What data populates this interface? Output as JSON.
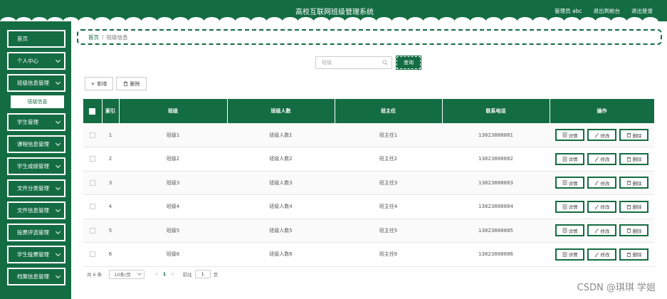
{
  "header": {
    "title": "高校互联网班级管理系统",
    "admin_label": "管理员 abc",
    "front_link": "退出到前台",
    "logout_link": "退出登录"
  },
  "sidebar": {
    "items": [
      {
        "label": "首页",
        "has_chevron": false
      },
      {
        "label": "个人中心",
        "has_chevron": true
      },
      {
        "label": "班级信息管理",
        "has_chevron": true
      },
      {
        "label": "学生管理",
        "has_chevron": true
      },
      {
        "label": "课程信息管理",
        "has_chevron": true
      },
      {
        "label": "学生成绩管理",
        "has_chevron": true
      },
      {
        "label": "文件分类管理",
        "has_chevron": true
      },
      {
        "label": "文件信息管理",
        "has_chevron": true
      },
      {
        "label": "投票评选管理",
        "has_chevron": true
      },
      {
        "label": "学生投票管理",
        "has_chevron": true
      },
      {
        "label": "档案信息管理",
        "has_chevron": true
      }
    ],
    "active_sub": "班级信息"
  },
  "breadcrumb": {
    "home": "首页",
    "separator": "/",
    "current": "班级信息"
  },
  "search": {
    "placeholder": "班级",
    "button": "查询"
  },
  "toolbar": {
    "add": "新增",
    "delete": "删除"
  },
  "table": {
    "headers": {
      "index": "索引",
      "class": "班级",
      "count": "班级人数",
      "teacher": "班主任",
      "phone": "联系电话",
      "ops": "操作"
    },
    "rows": [
      {
        "index": "1",
        "class": "班级1",
        "count": "班级人数1",
        "teacher": "班主任1",
        "phone": "13823888881"
      },
      {
        "index": "2",
        "class": "班级2",
        "count": "班级人数2",
        "teacher": "班主任2",
        "phone": "13823888882"
      },
      {
        "index": "3",
        "class": "班级3",
        "count": "班级人数3",
        "teacher": "班主任3",
        "phone": "13823888883"
      },
      {
        "index": "4",
        "class": "班级4",
        "count": "班级人数4",
        "teacher": "班主任4",
        "phone": "13823888884"
      },
      {
        "index": "5",
        "class": "班级5",
        "count": "班级人数5",
        "teacher": "班主任5",
        "phone": "13823888885"
      },
      {
        "index": "6",
        "class": "班级6",
        "count": "班级人数6",
        "teacher": "班主任6",
        "phone": "13823888886"
      }
    ],
    "row_actions": {
      "detail": "详情",
      "edit": "修改",
      "delete": "删除"
    }
  },
  "pagination": {
    "total": "共 6 条",
    "page_size": "10条/页",
    "prev": "<",
    "current": "1",
    "next": ">",
    "goto_label": "前往",
    "goto_value": "1",
    "page_suffix": "页"
  },
  "watermark": "CSDN @琪琪 学姐",
  "colors": {
    "primary": "#146c43"
  }
}
